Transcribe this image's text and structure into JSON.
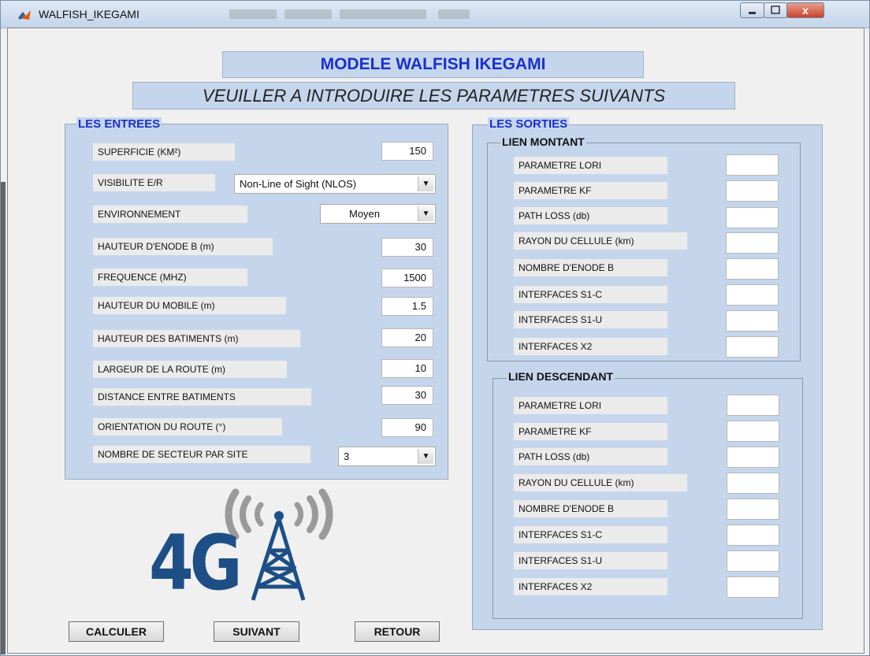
{
  "window": {
    "title": "WALFISH_IKEGAMI",
    "close_glyph": "x"
  },
  "header": {
    "title": "MODELE WALFISH IKEGAMI",
    "subtitle": "VEUILLER A INTRODUIRE LES PARAMETRES SUIVANTS"
  },
  "inputs_panel": {
    "title": "LES ENTREES",
    "fields": [
      {
        "label": "SUPERFICIE (KM²)",
        "value": "150"
      },
      {
        "label": "HAUTEUR D'ENODE B (m)",
        "value": "30"
      },
      {
        "label": "FREQUENCE (MHZ)",
        "value": "1500"
      },
      {
        "label": "HAUTEUR DU MOBILE (m)",
        "value": "1.5"
      },
      {
        "label": "HAUTEUR DES BATIMENTS (m)",
        "value": "20"
      },
      {
        "label": "LARGEUR DE LA ROUTE (m)",
        "value": "10"
      },
      {
        "label": "DISTANCE ENTRE BATIMENTS",
        "value": "30"
      },
      {
        "label": "ORIENTATION DU ROUTE (°)",
        "value": "90"
      }
    ],
    "visibility": {
      "label": "VISIBILITE E/R",
      "selected": "Non-Line of Sight (NLOS)"
    },
    "environment": {
      "label": "ENVIRONNEMENT",
      "selected": "Moyen"
    },
    "sectors": {
      "label": "NOMBRE DE SECTEUR PAR SITE",
      "selected": "3"
    }
  },
  "outputs_panel": {
    "title": "LES SORTIES",
    "uplink": {
      "title": "LIEN MONTANT",
      "labels": [
        "PARAMETRE LORI",
        "PARAMETRE KF",
        "PATH LOSS (db)",
        "RAYON DU CELLULE (km)",
        "NOMBRE D'ENODE B",
        "INTERFACES S1-C",
        "INTERFACES S1-U",
        "INTERFACES X2"
      ]
    },
    "downlink": {
      "title": "LIEN DESCENDANT",
      "labels": [
        "PARAMETRE LORI",
        "PARAMETRE KF",
        "PATH LOSS (db)",
        "RAYON DU CELLULE (km)",
        "NOMBRE D'ENODE B",
        "INTERFACES S1-C",
        "INTERFACES S1-U",
        "INTERFACES X2"
      ]
    }
  },
  "logo": {
    "text": "4G",
    "icon": "cell-tower-icon"
  },
  "buttons": {
    "calculate": "CALCULER",
    "next": "SUIVANT",
    "back": "RETOUR"
  },
  "colors": {
    "panel_bg": "#c5d6ec",
    "title_blue": "#1a2fd0",
    "logo_blue": "#1d4f86"
  }
}
